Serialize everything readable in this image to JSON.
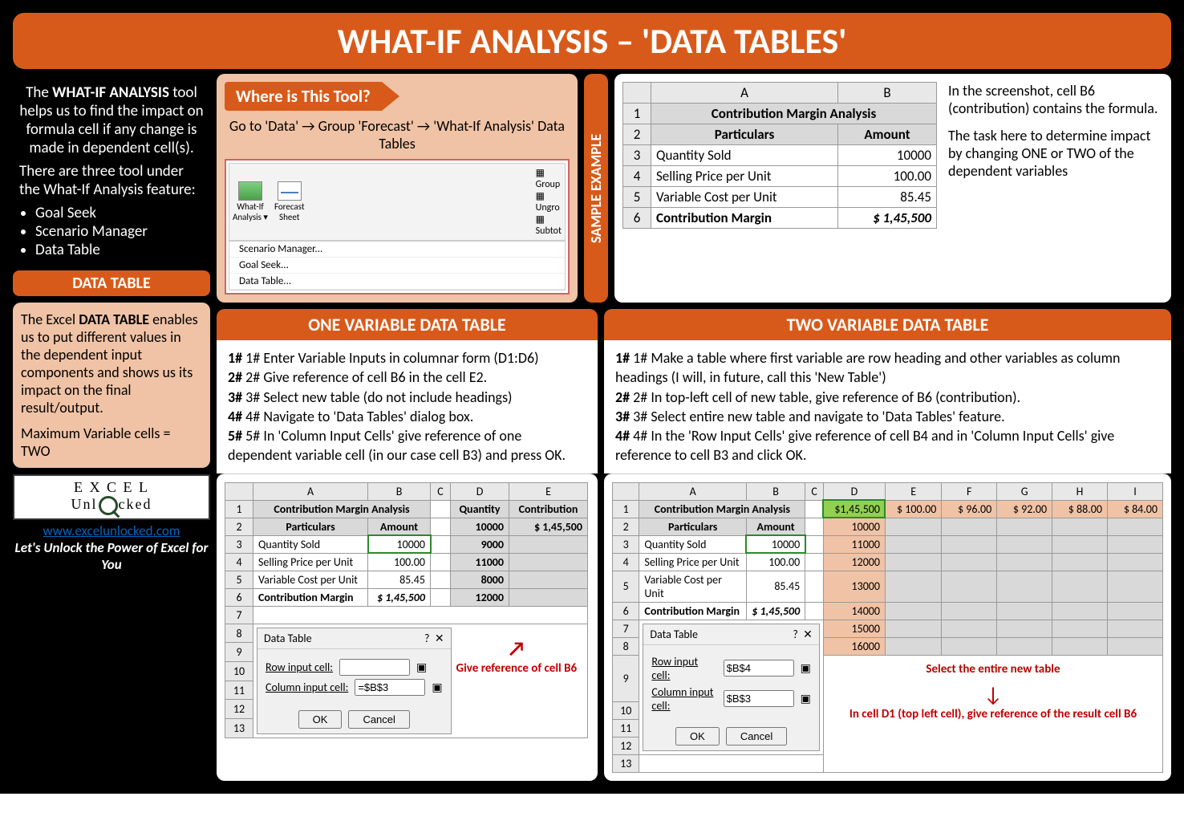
{
  "title": "WHAT-IF ANALYSIS – 'DATA TABLES'",
  "intro": {
    "p1a": "The ",
    "p1b": "WHAT-IF ANALYSIS",
    "p1c": " tool helps us to find the impact on formula cell if any change is made in dependent cell(s).",
    "p2": "There are three tool under the What-If Analysis feature:",
    "li1": "Goal Seek",
    "li2": "Scenario Manager",
    "li3": "Data Table"
  },
  "dt": {
    "head": "DATA TABLE",
    "p1a": "The Excel ",
    "p1b": "DATA TABLE",
    "p1c": " enables us to put different values in the dependent input components and shows us its impact on the final result/output.",
    "p2": "Maximum Variable cells = TWO"
  },
  "logo": {
    "l1": "E X C E L",
    "l2": "Unl  cked",
    "url": "www.excelunlocked.com",
    "tag": "Let's Unlock the Power of Excel for You"
  },
  "where": {
    "tag": "Where is This Tool?",
    "path": "Go to 'Data' → Group 'Forecast' → 'What-If Analysis' Data Tables",
    "btn1a": "What-If",
    "btn1b": "Analysis ▾",
    "btn2a": "Forecast",
    "btn2b": "Sheet",
    "m1": "Scenario Manager...",
    "m2": "Goal Seek...",
    "m3": "Data Table...",
    "g1": "Group",
    "g2": "Ungro",
    "g3": "Subtot"
  },
  "sample": {
    "vtab": "SAMPLE EXAMPLE",
    "title": "Contribution Margin Analysis",
    "h1": "Particulars",
    "h2": "Amount",
    "r1a": "Quantity Sold",
    "r1b": "10000",
    "r2a": "Selling Price per Unit",
    "r2b": "100.00",
    "r3a": "Variable Cost per Unit",
    "r3b": "85.45",
    "r4a": "Contribution Margin",
    "r4b": "$  1,45,500",
    "note1": "In the screenshot, cell B6 (contribution) contains the formula.",
    "note2": "The task here to determine impact by changing ONE or TWO of the dependent variables"
  },
  "one": {
    "head": "ONE VARIABLE DATA TABLE",
    "s1": "1# Enter Variable Inputs in columnar form (D1:D6)",
    "s2": "2# Give reference of cell B6 in the cell E2.",
    "s3": "3# Select new table (do not include headings)",
    "s4": "4# Navigate to 'Data Tables' dialog box.",
    "s5": "5# In 'Column Input Cells' give reference of one dependent variable cell (in our case cell B3) and press OK.",
    "qh": "Quantity",
    "ch": "Contribution",
    "q1": "10000",
    "c1": "$    1,45,500",
    "q2": "9000",
    "q3": "11000",
    "q4": "8000",
    "q5": "12000",
    "anno": "Give reference of cell B6"
  },
  "two": {
    "head": "TWO VARIABLE DATA TABLE",
    "s1": "1# Make a table where first variable are row heading and other variables as column headings (I will, in future, call this 'New Table')",
    "s2": "2# In top-left cell of new table, give reference of B6 (contribution).",
    "s3": "3# Select entire new table and navigate to 'Data Tables' feature.",
    "s4": "4# In the 'Row Input Cells' give reference of cell B4 and in 'Column Input Cells' give reference to cell B3 and click OK.",
    "d1": "$1,45,500",
    "e1": "$  100.00",
    "f1": "$    96.00",
    "g1": "$    92.00",
    "h1": "$    88.00",
    "i1": "$    84.00",
    "rv1": "10000",
    "rv2": "11000",
    "rv3": "12000",
    "rv4": "13000",
    "rv5": "14000",
    "rv6": "15000",
    "rv7": "16000",
    "anno1": "Select the entire new table",
    "anno2": "In cell D1 (top left cell), give reference of the result cell B6"
  },
  "dlg": {
    "title": "Data Table",
    "q": "?",
    "x": "✕",
    "row": "Row input cell:",
    "col": "Column input cell:",
    "val_row": "",
    "val_col": "=$B$3",
    "val_row2": "$B$4",
    "val_col2": "$B$3",
    "ok": "OK",
    "cancel": "Cancel"
  },
  "cols": {
    "A": "A",
    "B": "B",
    "C": "C",
    "D": "D",
    "E": "E",
    "F": "F",
    "G": "G",
    "H": "H",
    "I": "I"
  }
}
